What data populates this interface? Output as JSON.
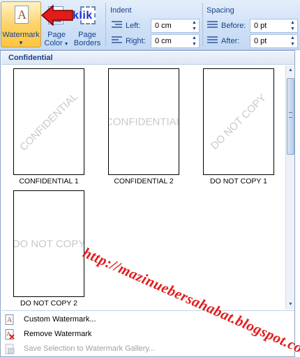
{
  "ribbon": {
    "watermark_label": "Watermark",
    "page_color_label_1": "Page",
    "page_color_label_2": "Color",
    "page_borders_label_1": "Page",
    "page_borders_label_2": "Borders",
    "indent": {
      "title": "Indent",
      "left_label": "Left:",
      "left_value": "0 cm",
      "right_label": "Right:",
      "right_value": "0 cm"
    },
    "spacing": {
      "title": "Spacing",
      "before_label": "Before:",
      "before_value": "0 pt",
      "after_label": "After:",
      "after_value": "0 pt"
    }
  },
  "annotation": {
    "klik_text": "klik",
    "url_text": "http://mazinuebersahabat.blogspot.com/"
  },
  "gallery": {
    "section_title": "Confidential",
    "items": [
      {
        "caption": "CONFIDENTIAL 1",
        "watermark": "CONFIDENTIAL",
        "orientation": "diagonal"
      },
      {
        "caption": "CONFIDENTIAL 2",
        "watermark": "CONFIDENTIAL",
        "orientation": "horizontal"
      },
      {
        "caption": "DO NOT COPY 1",
        "watermark": "DO NOT COPY",
        "orientation": "diagonal"
      },
      {
        "caption": "DO NOT COPY 2",
        "watermark": "DO NOT COPY",
        "orientation": "horizontal"
      }
    ]
  },
  "menu": {
    "items": [
      {
        "label": "Custom Watermark...",
        "icon": "custom-watermark-icon",
        "enabled": true
      },
      {
        "label": "Remove Watermark",
        "icon": "remove-watermark-icon",
        "enabled": true
      },
      {
        "label": "Save Selection to Watermark Gallery...",
        "icon": "save-to-gallery-icon",
        "enabled": false
      }
    ]
  },
  "colors": {
    "ribbon_text": "#15428b",
    "active_button": "#ffd36b",
    "annotation_red": "#e21b1b",
    "annotation_blue": "#1a2fd0"
  }
}
